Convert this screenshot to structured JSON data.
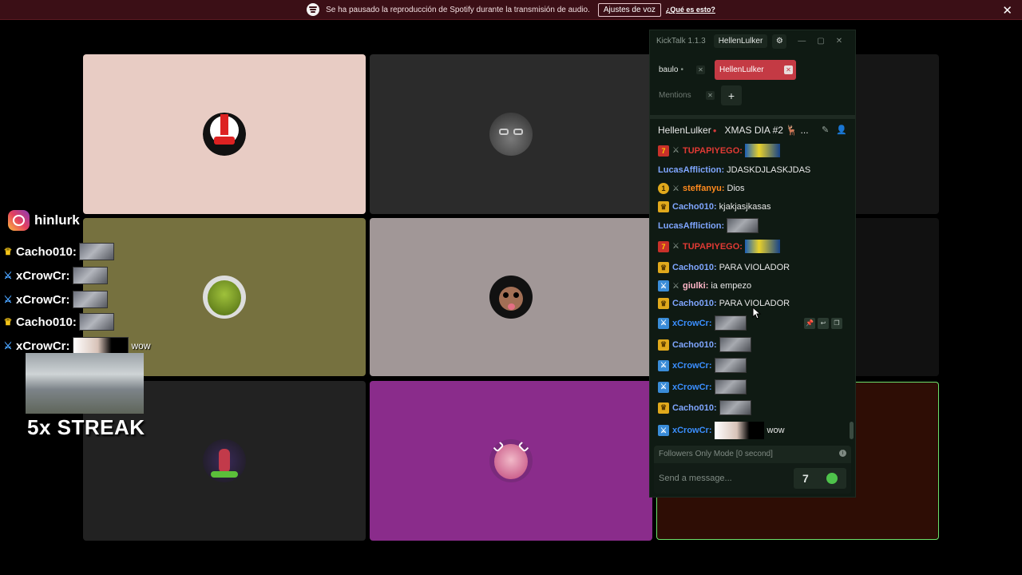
{
  "notice": {
    "message": "Se ha pausado la reproducción de Spotify durante la transmisión de audio.",
    "button": "Ajustes de voz",
    "link": "¿Qué es esto?",
    "close": "✕"
  },
  "overlay": {
    "instagram_handle": "hinlurk",
    "lines": [
      {
        "badge": "crown",
        "name": "Cacho010:",
        "text": ""
      },
      {
        "badge": "sub",
        "name": "xCrowCr:",
        "text": ""
      },
      {
        "badge": "sub",
        "name": "xCrowCr:",
        "text": ""
      },
      {
        "badge": "crown",
        "name": "Cacho010:",
        "text": ""
      },
      {
        "badge": "sub",
        "name": "xCrowCr:",
        "text": "wow"
      }
    ],
    "streak": "5x STREAK"
  },
  "tiles": [
    {
      "bg": "#e8ccc4",
      "avatar": "red-white-hat-avatar"
    },
    {
      "bg": "#2b2b2b",
      "avatar": "gray-cat-glasses-avatar"
    },
    {
      "bg": "#161616",
      "avatar": ""
    },
    {
      "bg": "#76713f",
      "avatar": "ogre-avatar"
    },
    {
      "bg": "#a19797",
      "avatar": "monkey-avatar"
    },
    {
      "bg": "#111111",
      "avatar": ""
    },
    {
      "bg": "#222222",
      "avatar": "anime-character-avatar"
    },
    {
      "bg": "#8a2c8b",
      "avatar": "pink-hair-catgirl-avatar"
    },
    {
      "bg": "#2e0d05",
      "avatar": ""
    }
  ],
  "kicktalk": {
    "app_title": "KickTalk 1.1.3",
    "user": "HellenLulker",
    "tabs": [
      {
        "label": "baulo",
        "dot": "•",
        "active": false
      },
      {
        "label": "HellenLulker",
        "active": true
      },
      {
        "label": "Mentions",
        "active": false
      }
    ],
    "add_tab": "+",
    "channel": "HellenLulker",
    "stream_title": "XMAS DIA #2 🦌 ...",
    "messages": [
      {
        "badge": "red",
        "sword": true,
        "name": "TUPAPIYEGO:",
        "color": "#e03a34",
        "text": "",
        "emote": "car"
      },
      {
        "badge": "",
        "sword": false,
        "name": "LucasAffliction:",
        "color": "#7fa6ff",
        "text": "JDASKDJLASKJDAS",
        "emote": ""
      },
      {
        "badge": "one",
        "sword": true,
        "name": "steffanyu:",
        "color": "#ff8a1e",
        "text": "Dios",
        "emote": ""
      },
      {
        "badge": "crown",
        "sword": false,
        "name": "Cacho010:",
        "color": "#7fa6ff",
        "text": "kjakjasjkasas",
        "emote": ""
      },
      {
        "badge": "",
        "sword": false,
        "name": "LucasAffliction:",
        "color": "#7fa6ff",
        "text": "",
        "emote": "thumb"
      },
      {
        "badge": "red",
        "sword": true,
        "name": "TUPAPIYEGO:",
        "color": "#e03a34",
        "text": "",
        "emote": "car"
      },
      {
        "badge": "crown",
        "sword": false,
        "name": "Cacho010:",
        "color": "#7fa6ff",
        "text": "PARA VIOLADOR",
        "emote": ""
      },
      {
        "badge": "sub",
        "sword": true,
        "name": "giulki:",
        "color": "#ffb6c8",
        "text": "ia empezo",
        "emote": ""
      },
      {
        "badge": "crown",
        "sword": false,
        "name": "Cacho010:",
        "color": "#7fa6ff",
        "text": "PARA VIOLADOR",
        "emote": ""
      },
      {
        "badge": "sub",
        "sword": false,
        "name": "xCrowCr:",
        "color": "#3b8fff",
        "text": "",
        "emote": "thumb"
      },
      {
        "badge": "crown",
        "sword": false,
        "name": "Cacho010:",
        "color": "#7fa6ff",
        "text": "",
        "emote": "thumb"
      },
      {
        "badge": "sub",
        "sword": false,
        "name": "xCrowCr:",
        "color": "#3b8fff",
        "text": "",
        "emote": "thumb"
      },
      {
        "badge": "sub",
        "sword": false,
        "name": "xCrowCr:",
        "color": "#3b8fff",
        "text": "",
        "emote": "thumb"
      },
      {
        "badge": "crown",
        "sword": false,
        "name": "Cacho010:",
        "color": "#7fa6ff",
        "text": "",
        "emote": "thumb"
      },
      {
        "badge": "sub",
        "sword": false,
        "name": "xCrowCr:",
        "color": "#3b8fff",
        "text": "wow",
        "emote": "face"
      }
    ],
    "chat_mode": "Followers Only Mode [0 second]",
    "input_placeholder": "Send a message..."
  }
}
